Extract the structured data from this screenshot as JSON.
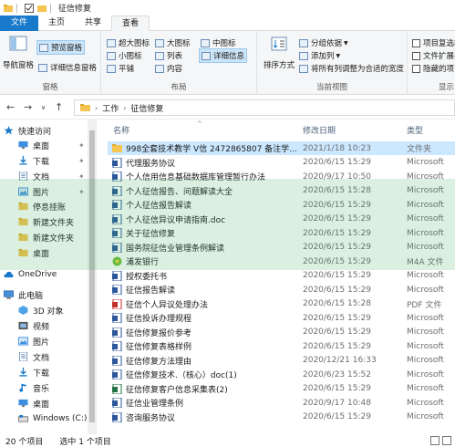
{
  "window": {
    "title": "征信修复"
  },
  "tabs": [
    {
      "label": "文件"
    },
    {
      "label": "主页"
    },
    {
      "label": "共享"
    },
    {
      "label": "查看"
    }
  ],
  "ribbon": {
    "pane": {
      "nav_pane": "导航窗格",
      "preview_pane": "预览窗格",
      "details_pane": "详细信息窗格",
      "group_label": "窗格"
    },
    "layout": {
      "xl_icons": "超大图标",
      "large_icons": "大图标",
      "medium_icons": "中图标",
      "small_icons": "小图标",
      "list": "列表",
      "details": "详细信息",
      "tiles": "平铺",
      "content": "内容",
      "group_label": "布局"
    },
    "current_view": {
      "sort_by": "排序方式",
      "group_by": "分组依据",
      "add_columns": "添加列",
      "size_columns": "将所有列调整为合适的宽度",
      "group_label": "当前视图"
    },
    "show_hide": {
      "item_checkboxes": "项目复选框",
      "file_ext": "文件扩展名",
      "hidden_items": "隐藏的项目",
      "group_label": "显示"
    }
  },
  "address": {
    "crumbs": [
      "工作",
      "征信修复"
    ]
  },
  "nav_pane": [
    {
      "label": "快速访问",
      "icon": "star-icon",
      "pinned": false,
      "level": 0
    },
    {
      "label": "桌面",
      "icon": "desktop-icon",
      "pinned": true,
      "level": 1
    },
    {
      "label": "下载",
      "icon": "download-icon",
      "pinned": true,
      "level": 1
    },
    {
      "label": "文档",
      "icon": "document-icon",
      "pinned": true,
      "level": 1
    },
    {
      "label": "图片",
      "icon": "picture-icon",
      "pinned": true,
      "level": 1
    },
    {
      "label": "停息挂账",
      "icon": "folder-icon",
      "pinned": false,
      "level": 1
    },
    {
      "label": "新建文件夹",
      "icon": "folder-icon",
      "pinned": false,
      "level": 1
    },
    {
      "label": "新建文件夹",
      "icon": "folder-icon",
      "pinned": false,
      "level": 1
    },
    {
      "label": "桌面",
      "icon": "folder-icon",
      "pinned": false,
      "level": 1
    },
    {
      "label": "OneDrive",
      "icon": "cloud-icon",
      "pinned": false,
      "level": 0
    },
    {
      "label": "此电脑",
      "icon": "computer-icon",
      "pinned": false,
      "level": 0
    },
    {
      "label": "3D 对象",
      "icon": "3d-objects-icon",
      "pinned": false,
      "level": 1
    },
    {
      "label": "视频",
      "icon": "video-icon",
      "pinned": false,
      "level": 1
    },
    {
      "label": "图片",
      "icon": "picture-icon",
      "pinned": false,
      "level": 1
    },
    {
      "label": "文档",
      "icon": "document-icon",
      "pinned": false,
      "level": 1
    },
    {
      "label": "下载",
      "icon": "download-icon",
      "pinned": false,
      "level": 1
    },
    {
      "label": "音乐",
      "icon": "music-icon",
      "pinned": false,
      "level": 1
    },
    {
      "label": "桌面",
      "icon": "desktop-icon",
      "pinned": false,
      "level": 1
    },
    {
      "label": "Windows (C:)",
      "icon": "drive-icon",
      "pinned": false,
      "level": 1
    }
  ],
  "columns": {
    "name": "名称",
    "date": "修改日期",
    "type": "类型"
  },
  "files": [
    {
      "name": "998全套技术教学  V信 2472865807  备注学...",
      "date": "2021/1/18 10:23",
      "type": "文件夹",
      "icon": "folder-icon",
      "selected": true
    },
    {
      "name": "代理服务协议",
      "date": "2020/6/15 15:29",
      "type": "Microsoft",
      "icon": "word-doc-icon"
    },
    {
      "name": "个人信用信息基础数据库管理暂行办法",
      "date": "2020/9/17 10:50",
      "type": "Microsoft",
      "icon": "word-doc-icon"
    },
    {
      "name": "个人征信报告、问题解读大全",
      "date": "2020/6/15 15:28",
      "type": "Microsoft",
      "icon": "word-doc-icon"
    },
    {
      "name": "个人征信报告解读",
      "date": "2020/6/15 15:29",
      "type": "Microsoft",
      "icon": "word-doc-icon"
    },
    {
      "name": "个人征信异议申请指南.doc",
      "date": "2020/6/15 15:29",
      "type": "Microsoft",
      "icon": "word-doc-icon"
    },
    {
      "name": "关于征信修复",
      "date": "2020/6/15 15:29",
      "type": "Microsoft",
      "icon": "word-doc-icon"
    },
    {
      "name": "国务院征信业管理条例解读",
      "date": "2020/6/15 15:29",
      "type": "Microsoft",
      "icon": "word-doc-icon"
    },
    {
      "name": "浦发银行",
      "date": "2020/6/15 15:29",
      "type": "M4A 文件",
      "icon": "audio-file-icon"
    },
    {
      "name": "授权委托书",
      "date": "2020/6/15 15:29",
      "type": "Microsoft",
      "icon": "word-doc-icon"
    },
    {
      "name": "征信报告解读",
      "date": "2020/6/15 15:29",
      "type": "Microsoft",
      "icon": "word-doc-icon"
    },
    {
      "name": "征信个人异议处理办法",
      "date": "2020/6/15 15:28",
      "type": "PDF 文件",
      "icon": "pdf-file-icon"
    },
    {
      "name": "征信投诉办理规程",
      "date": "2020/6/15 15:29",
      "type": "Microsoft",
      "icon": "word-doc-icon"
    },
    {
      "name": "征信修复报价参考",
      "date": "2020/6/15 15:29",
      "type": "Microsoft",
      "icon": "word-doc-icon"
    },
    {
      "name": "征信修复表格样例",
      "date": "2020/6/15 15:29",
      "type": "Microsoft",
      "icon": "word-doc-icon"
    },
    {
      "name": "征信修复方法理由",
      "date": "2020/12/21 16:33",
      "type": "Microsoft",
      "icon": "word-doc-icon"
    },
    {
      "name": "征信修复技术.（核心）doc(1)",
      "date": "2020/6/23 15:52",
      "type": "Microsoft",
      "icon": "word-doc-icon"
    },
    {
      "name": "征信修复客户信息采集表(2)",
      "date": "2020/6/15 15:29",
      "type": "Microsoft",
      "icon": "excel-file-icon"
    },
    {
      "name": "征信业管理条例",
      "date": "2020/9/17 10:48",
      "type": "Microsoft",
      "icon": "word-doc-icon"
    },
    {
      "name": "咨询服务协议",
      "date": "2020/6/15 15:29",
      "type": "Microsoft",
      "icon": "word-doc-icon"
    }
  ],
  "status": {
    "count": "20 个项目",
    "selected": "选中 1 个项目"
  },
  "colors": {
    "accent": "#1979ca",
    "selection": "#cce8ff",
    "folder": "#f5c451",
    "word": "#2b579a"
  }
}
